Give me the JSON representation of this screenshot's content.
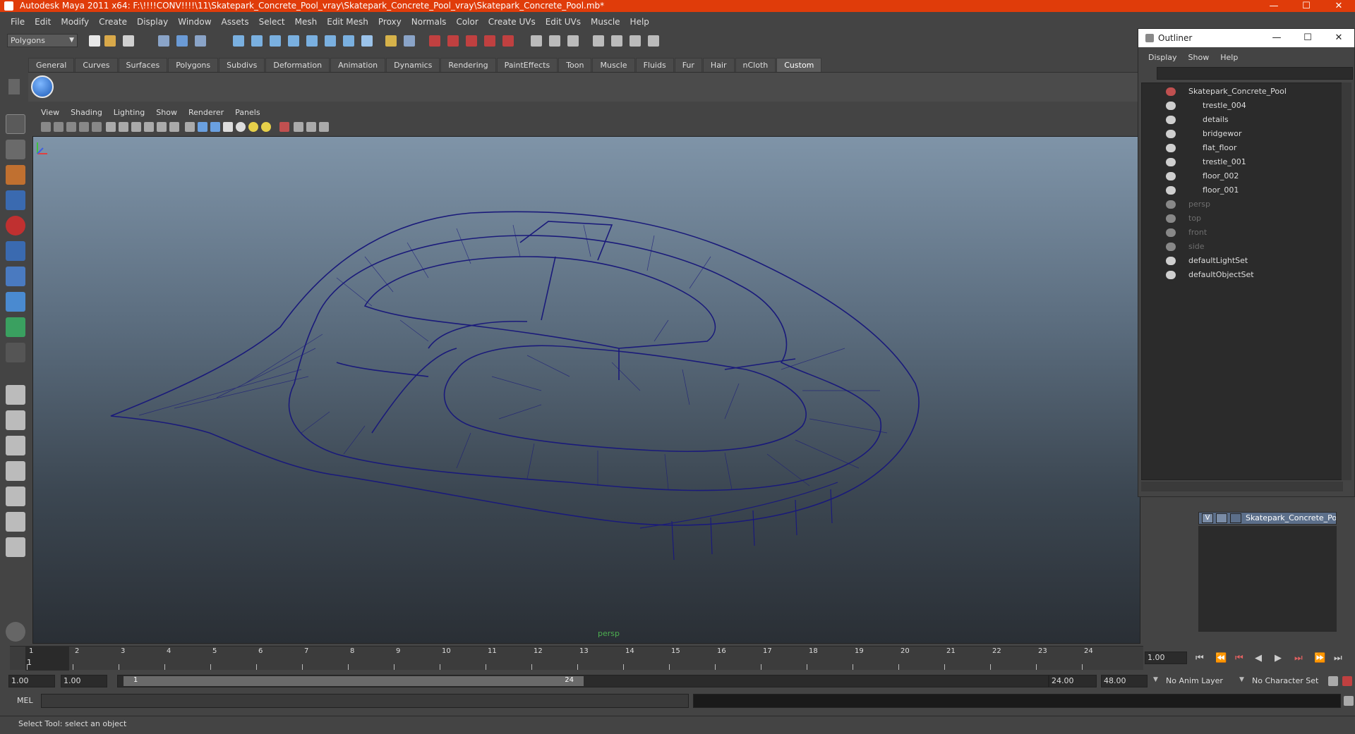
{
  "window": {
    "title": "Autodesk Maya 2011 x64: F:\\!!!!CONV!!!!\\11\\Skatepark_Concrete_Pool_vray\\Skatepark_Concrete_Pool_vray\\Skatepark_Concrete_Pool.mb*",
    "minimize": "—",
    "maximize": "☐",
    "close": "✕"
  },
  "menubar": [
    "File",
    "Edit",
    "Modify",
    "Create",
    "Display",
    "Window",
    "Assets",
    "Select",
    "Mesh",
    "Edit Mesh",
    "Proxy",
    "Normals",
    "Color",
    "Create UVs",
    "Edit UVs",
    "Muscle",
    "Help"
  ],
  "mode_selector": {
    "value": "Polygons"
  },
  "shelf_tabs": [
    "General",
    "Curves",
    "Surfaces",
    "Polygons",
    "Subdivs",
    "Deformation",
    "Animation",
    "Dynamics",
    "Rendering",
    "PaintEffects",
    "Toon",
    "Muscle",
    "Fluids",
    "Fur",
    "Hair",
    "nCloth",
    "Custom"
  ],
  "shelf_active_tab": "Custom",
  "panel_menu": [
    "View",
    "Shading",
    "Lighting",
    "Show",
    "Renderer",
    "Panels"
  ],
  "viewport": {
    "camera_label": "persp"
  },
  "outliner": {
    "title": "Outliner",
    "menu": [
      "Display",
      "Show",
      "Help"
    ],
    "items": [
      {
        "label": "Skatepark_Concrete_Pool",
        "level": 0,
        "dim": false,
        "icon": "transform-group-icon"
      },
      {
        "label": "trestle_004",
        "level": 1,
        "dim": false,
        "icon": "transform-icon"
      },
      {
        "label": "details",
        "level": 1,
        "dim": false,
        "icon": "transform-icon"
      },
      {
        "label": "bridgewor",
        "level": 1,
        "dim": false,
        "icon": "transform-icon"
      },
      {
        "label": "flat_floor",
        "level": 1,
        "dim": false,
        "icon": "transform-icon"
      },
      {
        "label": "trestle_001",
        "level": 1,
        "dim": false,
        "icon": "transform-icon"
      },
      {
        "label": "floor_002",
        "level": 1,
        "dim": false,
        "icon": "transform-icon"
      },
      {
        "label": "floor_001",
        "level": 1,
        "dim": false,
        "icon": "transform-icon"
      },
      {
        "label": "persp",
        "level": 0,
        "dim": true,
        "icon": "camera-icon"
      },
      {
        "label": "top",
        "level": 0,
        "dim": true,
        "icon": "camera-icon"
      },
      {
        "label": "front",
        "level": 0,
        "dim": true,
        "icon": "camera-icon"
      },
      {
        "label": "side",
        "level": 0,
        "dim": true,
        "icon": "camera-icon"
      },
      {
        "label": "defaultLightSet",
        "level": 0,
        "dim": false,
        "icon": "set-icon"
      },
      {
        "label": "defaultObjectSet",
        "level": 0,
        "dim": false,
        "icon": "set-icon"
      }
    ]
  },
  "layers": {
    "visible_flag": "V",
    "name": "Skatepark_Concrete_Poo"
  },
  "time_slider": {
    "ticks": [
      "1",
      "2",
      "3",
      "4",
      "5",
      "6",
      "7",
      "8",
      "9",
      "10",
      "11",
      "12",
      "13",
      "14",
      "15",
      "16",
      "17",
      "18",
      "19",
      "20",
      "21",
      "22",
      "23",
      "24"
    ],
    "current_frame_label": "1",
    "current_time": "1.00"
  },
  "range_slider": {
    "start_time": "1.00",
    "playback_start": "1.00",
    "range_start_label": "1",
    "range_end_label": "24",
    "playback_end": "24.00",
    "end_time": "48.00",
    "anim_layer": "No Anim Layer",
    "character_set": "No Character Set"
  },
  "command_line": {
    "label": "MEL"
  },
  "help_line": {
    "text": "Select Tool: select an object"
  },
  "colors": {
    "title_bar": "#e03c0a",
    "wireframe": "#1a1a7a",
    "layer_row": "#5c6f8a"
  }
}
